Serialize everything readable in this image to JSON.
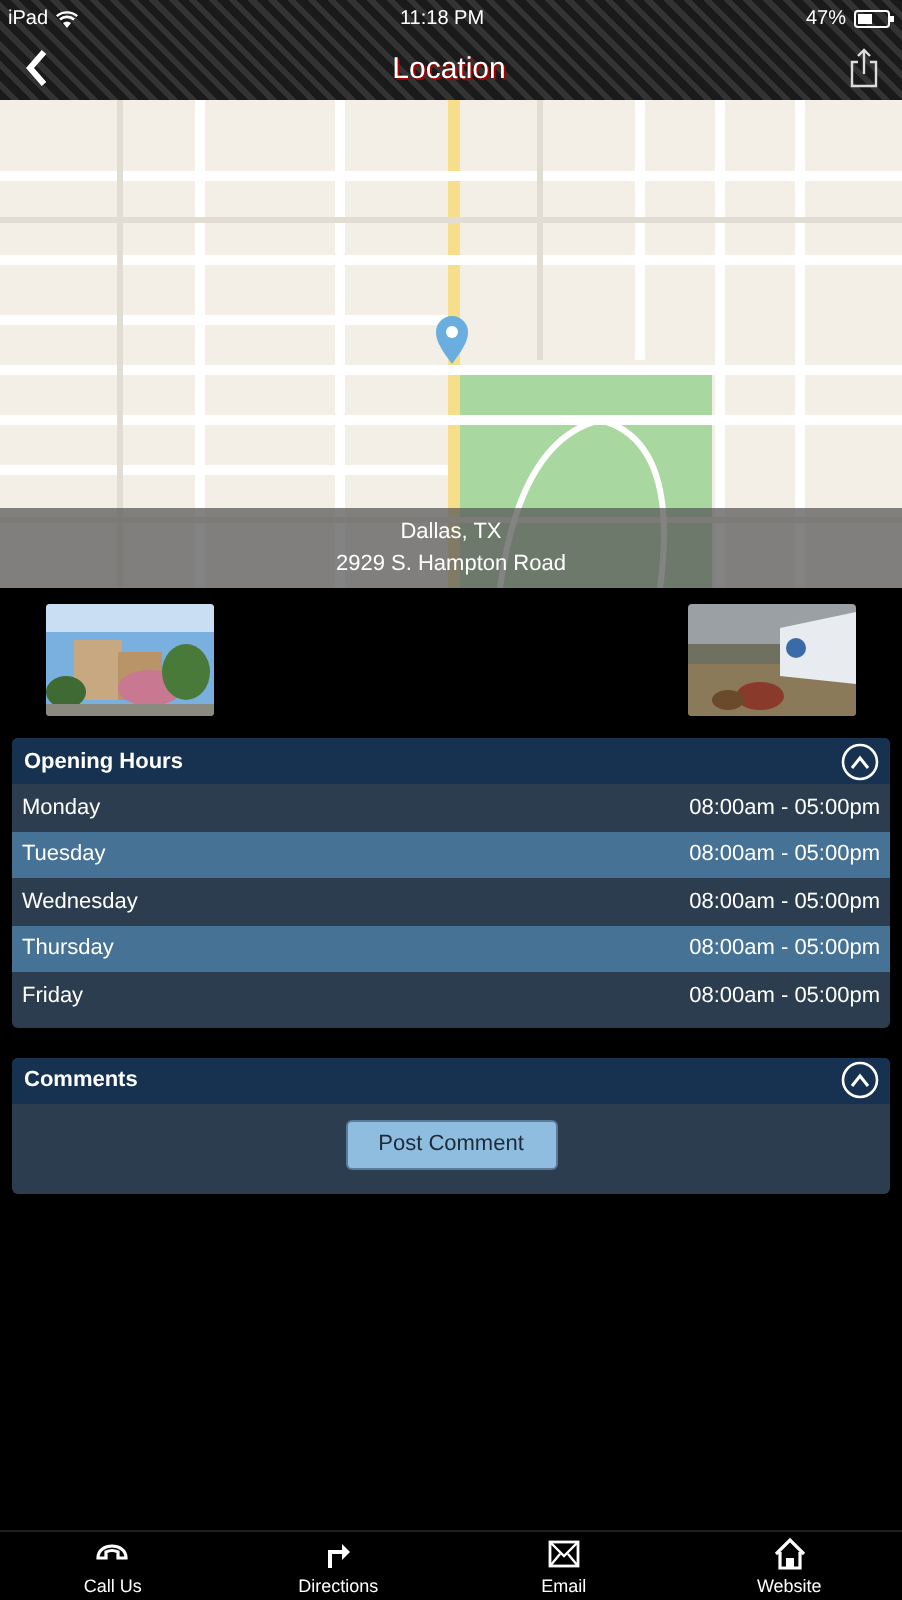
{
  "status_bar": {
    "device": "iPad",
    "time": "11:18 PM",
    "battery": "47%"
  },
  "nav": {
    "title": "Location"
  },
  "map": {
    "kind": "picture",
    "city": "Dallas, TX",
    "address": "2929 S. Hampton Road"
  },
  "opening_hours": {
    "title": "Opening Hours",
    "expanded": true,
    "rows": [
      {
        "day": "Monday",
        "hours": "08:00am - 05:00pm"
      },
      {
        "day": "Tuesday",
        "hours": "08:00am - 05:00pm"
      },
      {
        "day": "Wednesday",
        "hours": "08:00am - 05:00pm"
      },
      {
        "day": "Thursday",
        "hours": "08:00am - 05:00pm"
      },
      {
        "day": "Friday",
        "hours": "08:00am - 05:00pm"
      }
    ]
  },
  "comments": {
    "title": "Comments",
    "expanded": true,
    "button": "Post Comment"
  },
  "tab_bar": [
    {
      "kind": "phone",
      "label": "Call Us"
    },
    {
      "kind": "directions",
      "label": "Directions"
    },
    {
      "kind": "email",
      "label": "Email"
    },
    {
      "kind": "home",
      "label": "Website"
    }
  ]
}
